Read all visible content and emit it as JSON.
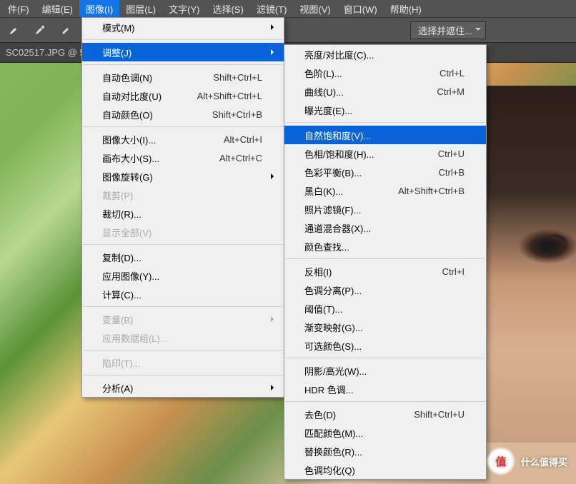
{
  "menubar": [
    {
      "label": "件(F)"
    },
    {
      "label": "编辑(E)"
    },
    {
      "label": "图像(I)",
      "hl": true
    },
    {
      "label": "图层(L)"
    },
    {
      "label": "文字(Y)"
    },
    {
      "label": "选择(S)"
    },
    {
      "label": "滤镜(T)"
    },
    {
      "label": "视图(V)"
    },
    {
      "label": "窗口(W)"
    },
    {
      "label": "帮助(H)"
    }
  ],
  "toolbar": {
    "combo_label": "选择并遮住..."
  },
  "tab": {
    "label": "SC02517.JPG @ 5"
  },
  "menu1": [
    {
      "label": "模式(M)",
      "sub": true
    },
    "sep",
    {
      "label": "调整(J)",
      "sub": true,
      "hl": true
    },
    "sep",
    {
      "label": "自动色调(N)",
      "sc": "Shift+Ctrl+L"
    },
    {
      "label": "自动对比度(U)",
      "sc": "Alt+Shift+Ctrl+L"
    },
    {
      "label": "自动颜色(O)",
      "sc": "Shift+Ctrl+B"
    },
    "sep",
    {
      "label": "图像大小(I)...",
      "sc": "Alt+Ctrl+I"
    },
    {
      "label": "画布大小(S)...",
      "sc": "Alt+Ctrl+C"
    },
    {
      "label": "图像旋转(G)",
      "sub": true
    },
    {
      "label": "裁剪(P)",
      "dis": true
    },
    {
      "label": "裁切(R)..."
    },
    {
      "label": "显示全部(V)",
      "dis": true
    },
    "sep",
    {
      "label": "复制(D)..."
    },
    {
      "label": "应用图像(Y)..."
    },
    {
      "label": "计算(C)..."
    },
    "sep",
    {
      "label": "变量(B)",
      "sub": true,
      "dis": true
    },
    {
      "label": "应用数据组(L)...",
      "dis": true
    },
    "sep",
    {
      "label": "陷印(T)...",
      "dis": true
    },
    "sep",
    {
      "label": "分析(A)",
      "sub": true
    }
  ],
  "menu2": [
    {
      "label": "亮度/对比度(C)..."
    },
    {
      "label": "色阶(L)...",
      "sc": "Ctrl+L"
    },
    {
      "label": "曲线(U)...",
      "sc": "Ctrl+M"
    },
    {
      "label": "曝光度(E)..."
    },
    "sep",
    {
      "label": "自然饱和度(V)...",
      "hl": true
    },
    {
      "label": "色相/饱和度(H)...",
      "sc": "Ctrl+U"
    },
    {
      "label": "色彩平衡(B)...",
      "sc": "Ctrl+B"
    },
    {
      "label": "黑白(K)...",
      "sc": "Alt+Shift+Ctrl+B"
    },
    {
      "label": "照片滤镜(F)..."
    },
    {
      "label": "通道混合器(X)..."
    },
    {
      "label": "颜色查找..."
    },
    "sep",
    {
      "label": "反相(I)",
      "sc": "Ctrl+I"
    },
    {
      "label": "色调分离(P)..."
    },
    {
      "label": "阈值(T)..."
    },
    {
      "label": "渐变映射(G)..."
    },
    {
      "label": "可选颜色(S)..."
    },
    "sep",
    {
      "label": "阴影/高光(W)..."
    },
    {
      "label": "HDR 色调..."
    },
    "sep",
    {
      "label": "去色(D)",
      "sc": "Shift+Ctrl+U"
    },
    {
      "label": "匹配颜色(M)..."
    },
    {
      "label": "替换颜色(R)..."
    },
    {
      "label": "色调均化(Q)"
    }
  ],
  "watermark": {
    "badge": "值",
    "text": "什么值得买"
  }
}
